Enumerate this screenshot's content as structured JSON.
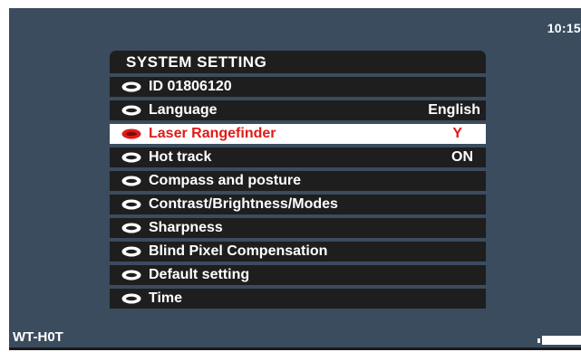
{
  "status": {
    "clock": "10:15",
    "brand": "WT-H0T"
  },
  "menu": {
    "title": "SYSTEM SETTING",
    "items": [
      {
        "label": "ID  01806120",
        "value": ""
      },
      {
        "label": "Language",
        "value": "English"
      },
      {
        "label": "Laser Rangefinder",
        "value": "Y"
      },
      {
        "label": "Hot track",
        "value": "ON"
      },
      {
        "label": "Compass and posture",
        "value": ""
      },
      {
        "label": "Contrast/Brightness/Modes",
        "value": ""
      },
      {
        "label": "Sharpness",
        "value": ""
      },
      {
        "label": "Blind Pixel Compensation",
        "value": ""
      },
      {
        "label": "Default setting",
        "value": ""
      },
      {
        "label": "Time",
        "value": ""
      }
    ],
    "selected_index": 2
  },
  "colors": {
    "background": "#3a4c5e",
    "menu_row": "#1e1e1e",
    "selected_row": "#ffffff",
    "selected_text": "#e01a1a"
  },
  "icons": {
    "bullet": "radio-bullet-icon",
    "battery": "battery-icon"
  }
}
